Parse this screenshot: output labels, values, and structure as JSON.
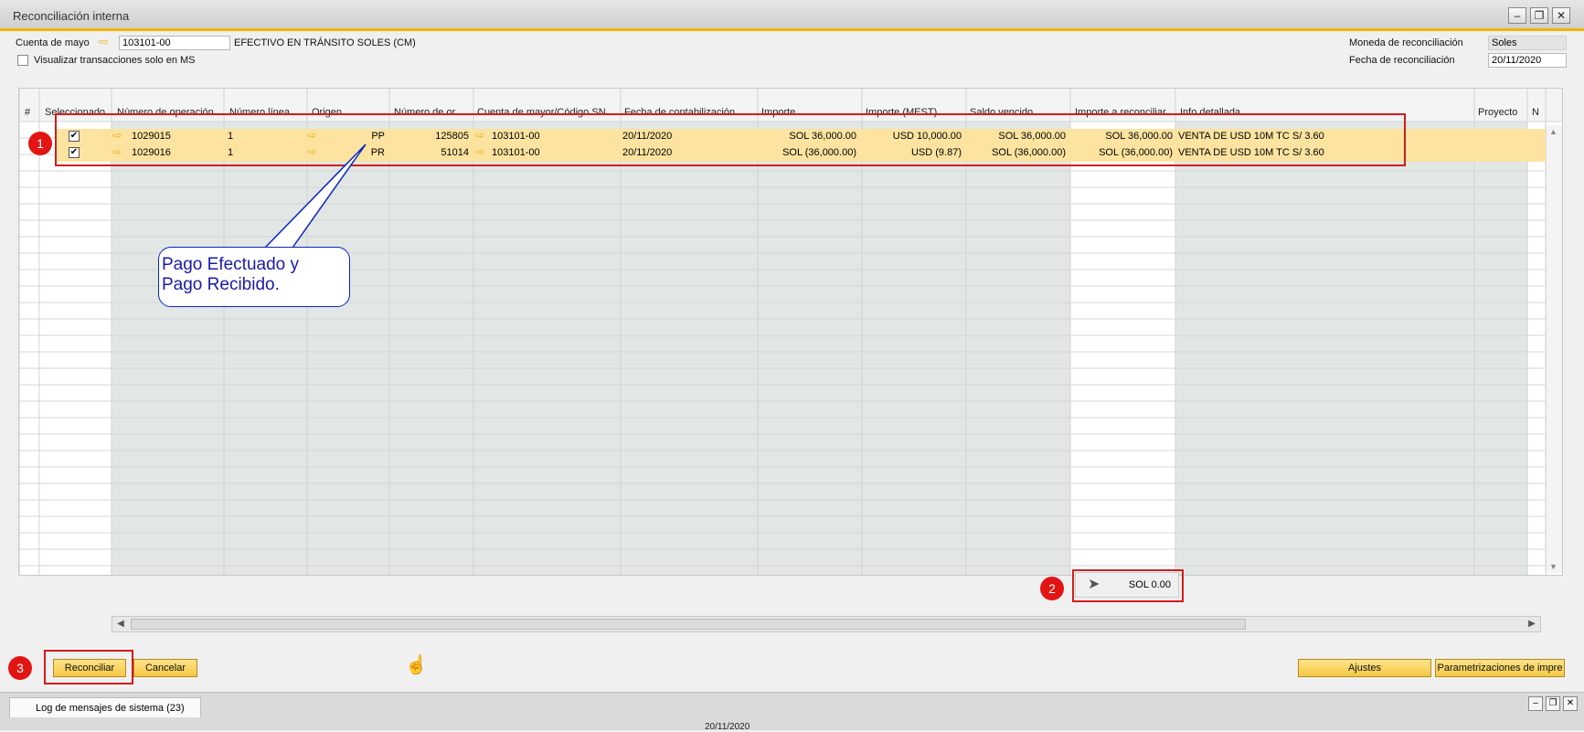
{
  "window": {
    "title": "Reconciliación interna"
  },
  "header": {
    "account_label": "Cuenta de mayo",
    "account_value": "103101-00",
    "account_name": "EFECTIVO EN TRÁNSITO SOLES (CM)",
    "show_ms_label": "Visualizar transacciones solo en MS",
    "currency_label": "Moneda de reconciliación",
    "currency_value": "Soles",
    "date_label": "Fecha de reconciliación",
    "date_value": "20/11/2020"
  },
  "grid": {
    "columns": [
      "#",
      "Seleccionado",
      "Número de operación",
      "Número línea ...",
      "Origen",
      "Número de or...",
      "Cuenta de mayor/Código SN",
      "Fecha de contabilización",
      "Importe",
      "Importe (MEST)",
      "Saldo vencido",
      "Importe a reconciliar",
      "Info.detallada",
      "Proyecto",
      "N"
    ],
    "rows": [
      {
        "selected": true,
        "op_number": "1029015",
        "line": "1",
        "origin": "PP",
        "orig_number": "125805",
        "account": "103101-00",
        "date": "20/11/2020",
        "amount": "SOL  36,000.00",
        "amount_fc": "USD  10,000.00",
        "balance": "SOL  36,000.00",
        "to_reconcile": "SOL  36,000.00",
        "details": "VENTA DE USD 10M TC S/ 3.60"
      },
      {
        "selected": true,
        "op_number": "1029016",
        "line": "1",
        "origin": "PR",
        "orig_number": "51014",
        "account": "103101-00",
        "date": "20/11/2020",
        "amount": "SOL (36,000.00)",
        "amount_fc": "USD (9.87)",
        "balance": "SOL (36,000.00)",
        "to_reconcile": "SOL (36,000.00)",
        "details": "VENTA DE USD 10M TC S/ 3.60"
      }
    ],
    "total": "SOL 0.00"
  },
  "annotations": {
    "badge1": "1",
    "badge2": "2",
    "badge3": "3",
    "callout_line1": "Pago Efectuado y",
    "callout_line2": "Pago Recibido."
  },
  "buttons": {
    "reconcile": "Reconciliar",
    "cancel": "Cancelar",
    "adjustments": "Ajustes",
    "print_settings": "Parametrizaciones de impre"
  },
  "status": {
    "log_tab": "Log de mensajes de sistema (23)",
    "date": "20/11/2020"
  },
  "colors": {
    "accent": "#f0b400",
    "selected_row": "#fce3a0",
    "annotation_red": "#d21c1c",
    "callout_blue": "#0a28c0"
  }
}
